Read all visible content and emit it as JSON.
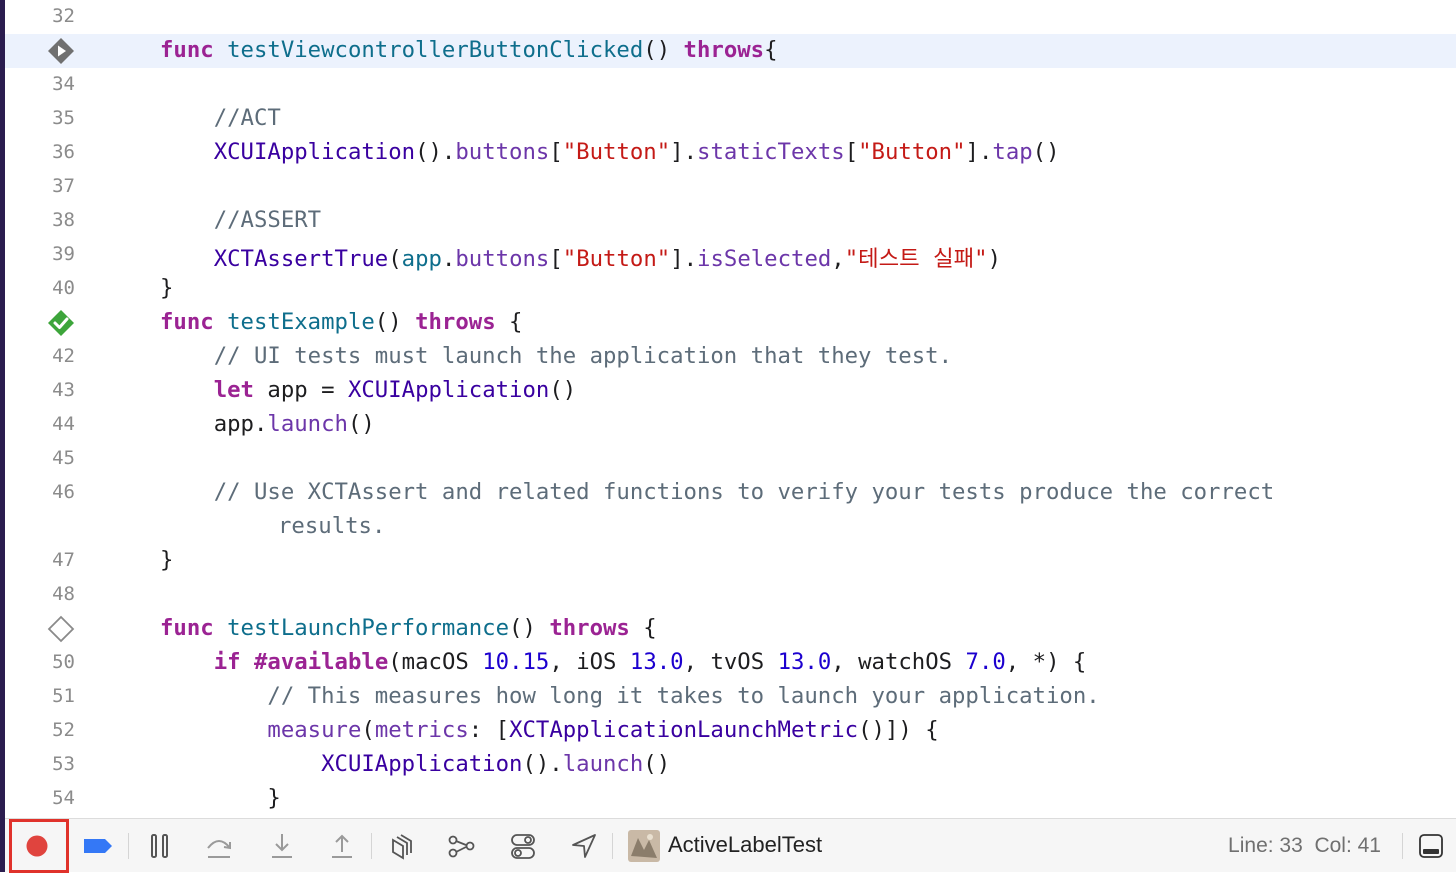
{
  "editor": {
    "lines": [
      {
        "n": "32"
      },
      {
        "n": "",
        "highlight": true,
        "gutter": "test-diamond-run-icon",
        "segs": [
          [
            "kw",
            "func "
          ],
          [
            "fn",
            "testViewcontrollerButtonClicked"
          ],
          [
            "pl",
            "() "
          ],
          [
            "kw",
            "throws"
          ],
          [
            "pl",
            "{"
          ]
        ]
      },
      {
        "n": "34"
      },
      {
        "n": "35",
        "segs": [
          [
            "cm",
            "    //ACT"
          ]
        ]
      },
      {
        "n": "36",
        "segs": [
          [
            "pl",
            "    "
          ],
          [
            "ty",
            "XCUIApplication"
          ],
          [
            "pl",
            "()."
          ],
          [
            "mth",
            "buttons"
          ],
          [
            "pl",
            "["
          ],
          [
            "str",
            "\"Button\""
          ],
          [
            "pl",
            "]."
          ],
          [
            "mth",
            "staticTexts"
          ],
          [
            "pl",
            "["
          ],
          [
            "str",
            "\"Button\""
          ],
          [
            "pl",
            "]."
          ],
          [
            "mth",
            "tap"
          ],
          [
            "pl",
            "()"
          ]
        ]
      },
      {
        "n": "37"
      },
      {
        "n": "38",
        "segs": [
          [
            "cm",
            "    //ASSERT"
          ]
        ]
      },
      {
        "n": "39",
        "segs": [
          [
            "pl",
            "    "
          ],
          [
            "ty",
            "XCTAssertTrue"
          ],
          [
            "pl",
            "("
          ],
          [
            "fn",
            "app"
          ],
          [
            "pl",
            "."
          ],
          [
            "mth",
            "buttons"
          ],
          [
            "pl",
            "["
          ],
          [
            "str",
            "\"Button\""
          ],
          [
            "pl",
            "]."
          ],
          [
            "mth",
            "isSelected"
          ],
          [
            "pl",
            ","
          ],
          [
            "str",
            "\"테스트 실패\""
          ],
          [
            "pl",
            ")"
          ]
        ]
      },
      {
        "n": "40",
        "segs": [
          [
            "pl",
            "}"
          ]
        ]
      },
      {
        "n": "",
        "gutter": "test-passed-icon",
        "segs": [
          [
            "kw",
            "func "
          ],
          [
            "fn",
            "testExample"
          ],
          [
            "pl",
            "() "
          ],
          [
            "kw",
            "throws"
          ],
          [
            "pl",
            " {"
          ]
        ]
      },
      {
        "n": "42",
        "segs": [
          [
            "cm",
            "    // UI tests must launch the application that they test."
          ]
        ]
      },
      {
        "n": "43",
        "segs": [
          [
            "pl",
            "    "
          ],
          [
            "kw",
            "let"
          ],
          [
            "pl",
            " app = "
          ],
          [
            "ty",
            "XCUIApplication"
          ],
          [
            "pl",
            "()"
          ]
        ]
      },
      {
        "n": "44",
        "segs": [
          [
            "pl",
            "    app."
          ],
          [
            "mth",
            "launch"
          ],
          [
            "pl",
            "()"
          ]
        ]
      },
      {
        "n": "45"
      },
      {
        "n": "46",
        "segs": [
          [
            "cm",
            "    // Use XCTAssert and related functions to verify your tests produce the correct"
          ]
        ]
      },
      {
        "n": "",
        "wrap": true,
        "segs": [
          [
            "cm",
            "results."
          ]
        ]
      },
      {
        "n": "47",
        "segs": [
          [
            "pl",
            "}"
          ]
        ]
      },
      {
        "n": "48"
      },
      {
        "n": "",
        "gutter": "test-diamond-icon",
        "segs": [
          [
            "kw",
            "func "
          ],
          [
            "fn",
            "testLaunchPerformance"
          ],
          [
            "pl",
            "() "
          ],
          [
            "kw",
            "throws"
          ],
          [
            "pl",
            " {"
          ]
        ]
      },
      {
        "n": "50",
        "segs": [
          [
            "pl",
            "    "
          ],
          [
            "kw",
            "if"
          ],
          [
            "pl",
            " "
          ],
          [
            "kw",
            "#available"
          ],
          [
            "pl",
            "(macOS "
          ],
          [
            "num",
            "10.15"
          ],
          [
            "pl",
            ", iOS "
          ],
          [
            "num",
            "13.0"
          ],
          [
            "pl",
            ", tvOS "
          ],
          [
            "num",
            "13.0"
          ],
          [
            "pl",
            ", watchOS "
          ],
          [
            "num",
            "7.0"
          ],
          [
            "pl",
            ", *) {"
          ]
        ]
      },
      {
        "n": "51",
        "segs": [
          [
            "cm",
            "        // This measures how long it takes to launch your application."
          ]
        ]
      },
      {
        "n": "52",
        "segs": [
          [
            "pl",
            "        "
          ],
          [
            "mth",
            "measure"
          ],
          [
            "pl",
            "("
          ],
          [
            "mth",
            "metrics"
          ],
          [
            "pl",
            ": ["
          ],
          [
            "ty",
            "XCTApplicationLaunchMetric"
          ],
          [
            "pl",
            "()]) {"
          ]
        ]
      },
      {
        "n": "53",
        "segs": [
          [
            "pl",
            "            "
          ],
          [
            "ty",
            "XCUIApplication"
          ],
          [
            "pl",
            "()."
          ],
          [
            "mth",
            "launch"
          ],
          [
            "pl",
            "()"
          ]
        ]
      },
      {
        "n": "54",
        "segs": [
          [
            "pl",
            "        }"
          ]
        ]
      }
    ]
  },
  "debug_bar": {
    "target_name": "ActiveLabelTest",
    "line_label": "Line: 33",
    "col_label": "Col: 41",
    "icons": [
      "breakpoint-record-icon",
      "breakpoints-toggle-icon",
      "pause-icon",
      "step-over-icon",
      "step-into-icon",
      "step-out-icon",
      "view-hierarchy-icon",
      "memory-graph-icon",
      "environment-overrides-icon",
      "simulate-location-icon",
      "app-icon",
      "hide-debug-area-icon"
    ]
  },
  "colors": {
    "keyword": "#9b2393",
    "function": "#0e6e8c",
    "type": "#3900a0",
    "method": "#6c36a9",
    "string": "#c41a16",
    "number": "#1c00cf",
    "comment": "#5d6c79",
    "highlight": "#ecf2fd",
    "accent": "#3478f6"
  }
}
